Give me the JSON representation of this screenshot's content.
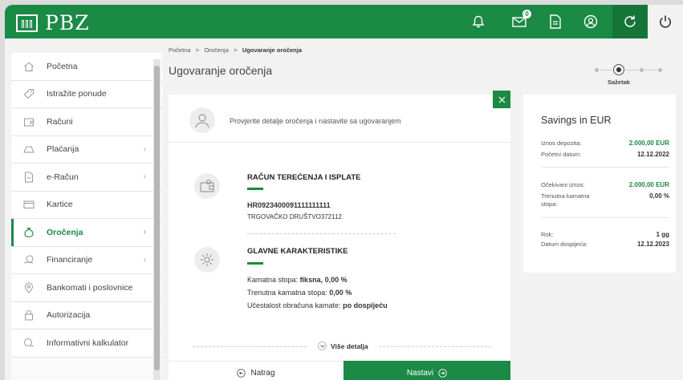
{
  "brand": {
    "name": "PBZ",
    "color": "#1a8a45"
  },
  "topbar": {
    "icons": [
      "bell-icon",
      "mail-icon",
      "document-icon",
      "user-icon",
      "refresh-icon",
      "power-icon"
    ],
    "mail_badge": "0"
  },
  "breadcrumb": {
    "items": [
      "Početna",
      "Oročenja"
    ],
    "current": "Ugovaranje oročenja",
    "separator": ">"
  },
  "page_title": "Ugovaranje oročenja",
  "stepper": {
    "current_label": "Sažetak",
    "total_steps": 4,
    "current_step": 2
  },
  "sidebar": {
    "items": [
      {
        "label": "Početna",
        "icon": "home-icon",
        "has_chevron": false,
        "active": false
      },
      {
        "label": "Istražite ponude",
        "icon": "tag-icon",
        "has_chevron": false,
        "active": false
      },
      {
        "label": "Računi",
        "icon": "wallet-icon",
        "has_chevron": false,
        "active": false
      },
      {
        "label": "Plaćanja",
        "icon": "payment-icon",
        "has_chevron": true,
        "active": false
      },
      {
        "label": "e-Račun",
        "icon": "e-bill-icon",
        "has_chevron": true,
        "active": false
      },
      {
        "label": "Kartice",
        "icon": "card-icon",
        "has_chevron": false,
        "active": false
      },
      {
        "label": "Oročenja",
        "icon": "savings-icon",
        "has_chevron": true,
        "active": true
      },
      {
        "label": "Financiranje",
        "icon": "financing-icon",
        "has_chevron": true,
        "active": false
      },
      {
        "label": "Bankomati i poslovnice",
        "icon": "location-icon",
        "has_chevron": false,
        "active": false
      },
      {
        "label": "Autorizacija",
        "icon": "lock-icon",
        "has_chevron": false,
        "active": false
      },
      {
        "label": "Informativni kalkulator",
        "icon": "calculator-icon",
        "has_chevron": false,
        "active": false
      }
    ]
  },
  "main": {
    "intro_text": "Provjerite detalje oročenja i nastavite sa ugovaranjem",
    "account": {
      "title": "RAČUN TEREĆENJA I ISPLATE",
      "iban": "HR0923400091111111111",
      "holder": "TRGOVAČKO DRUŠTVO372112"
    },
    "details": {
      "title": "GLAVNE KARAKTERISTIKE",
      "rate_type_label": "Kamatna stopa:",
      "rate_type_value": "fiksna, 0,00 %",
      "current_rate_label": "Trenutna kamatna stopa:",
      "current_rate_value": "0,00 %",
      "frequency_label": "Učestalost obračuna kamate:",
      "frequency_value": "po dospijeću"
    },
    "more_details": "Više detalja",
    "back_button": "Natrag",
    "next_button": "Nastavi"
  },
  "summary": {
    "title": "Savings in EUR",
    "rows": [
      {
        "label": "Iznos depozita:",
        "value": "2.000,00 EUR",
        "green": true
      },
      {
        "label": "Početni datum:",
        "value": "12.12.2022",
        "green": false
      },
      {
        "label": "Očekivani iznos:",
        "value": "2.000,00 EUR",
        "green": true
      },
      {
        "label": "Trenutna kamatna stopa:",
        "value": "0,00 %",
        "green": false
      },
      {
        "label": "Rok:",
        "value": "1 gg",
        "green": false
      },
      {
        "label": "Datum dospijeća:",
        "value": "12.12.2023",
        "green": false
      }
    ]
  }
}
